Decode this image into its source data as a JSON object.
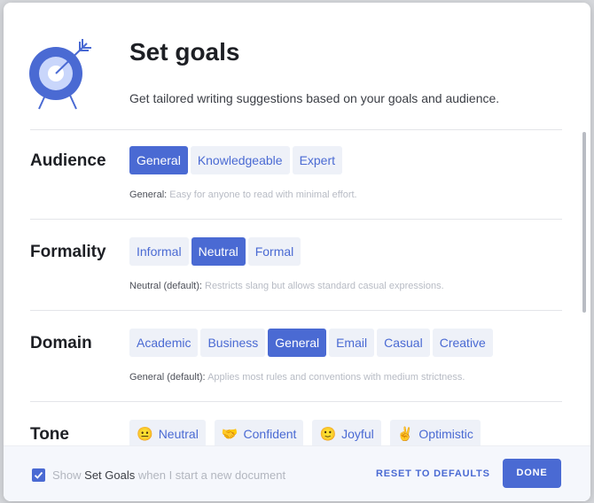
{
  "header": {
    "title": "Set goals",
    "subtitle": "Get tailored writing suggestions based on your goals and audience."
  },
  "sections": [
    {
      "label": "Audience",
      "options": [
        "General",
        "Knowledgeable",
        "Expert"
      ],
      "selected": "General",
      "desc_key": "General:",
      "desc_text": "Easy for anyone to read with minimal effort."
    },
    {
      "label": "Formality",
      "options": [
        "Informal",
        "Neutral",
        "Formal"
      ],
      "selected": "Neutral",
      "desc_key": "Neutral (default):",
      "desc_text": "Restricts slang but allows standard casual expressions."
    },
    {
      "label": "Domain",
      "options": [
        "Academic",
        "Business",
        "General",
        "Email",
        "Casual",
        "Creative"
      ],
      "selected": "General",
      "desc_key": "General (default):",
      "desc_text": "Applies most rules and conventions with medium strictness."
    },
    {
      "label": "Tone",
      "options": [
        {
          "emoji": "😐",
          "label": "Neutral"
        },
        {
          "emoji": "🤝",
          "label": "Confident"
        },
        {
          "emoji": "🙂",
          "label": "Joyful"
        },
        {
          "emoji": "✌️",
          "label": "Optimistic"
        }
      ]
    }
  ],
  "footer": {
    "checkbox_checked": true,
    "check_prefix": "Show",
    "check_strong": "Set Goals",
    "check_suffix": "when I start a new document",
    "reset_label": "RESET TO DEFAULTS",
    "done_label": "DONE"
  },
  "colors": {
    "accent": "#4a6ad3",
    "option_bg": "#eef1f8",
    "target_light": "#c9d6fb"
  }
}
